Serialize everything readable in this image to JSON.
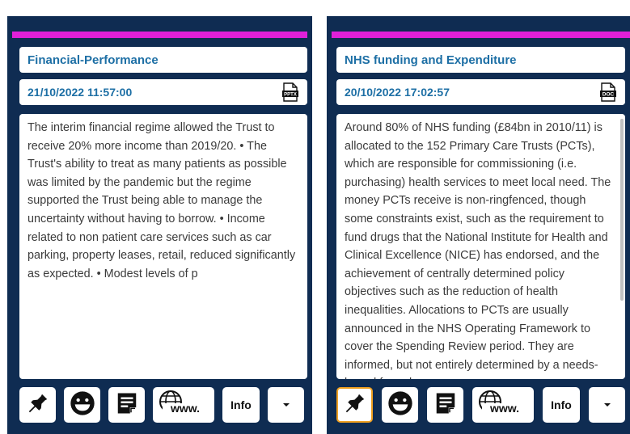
{
  "cards": [
    {
      "title": "Financial-Performance",
      "date": "21/10/2022 11:57:00",
      "file_type": "PPTX",
      "file_icon": "pptx-file-icon",
      "body": "The interim financial regime allowed the Trust to receive 20% more income than 2019/20. • The Trust's ability to treat as many patients as possible was limited by the pandemic but the regime supported the Trust being able to manage the uncertainty without having to borrow. • Income related to non patient care services such as car parking, property leases, retail, reduced significantly as expected. • Modest levels of p",
      "pin_active": false,
      "info_label": "Info"
    },
    {
      "title": "NHS funding and Expenditure",
      "date": "20/10/2022 17:02:57",
      "file_type": "DOC",
      "file_icon": "doc-file-icon",
      "body": "Around 80% of NHS funding (£84bn in 2010/11) is allocated to the 152 Primary Care Trusts (PCTs), which are responsible for commissioning (i.e. purchasing) health services to meet local need. The money PCTs receive is non-ringfenced, though some constraints exist, such as the requirement to fund drugs that the National Institute for Health and Clinical Excellence (NICE) has endorsed, and the achievement of centrally determined policy objectives such as the reduction of health inequalities. Allocations to PCTs are usually announced in the NHS Operating Framework to cover the Spending Review period. They are informed, but not entirely determined by a needs-based formula",
      "pin_active": true,
      "info_label": "Info"
    }
  ],
  "colors": {
    "card_bg": "#0f2c52",
    "accent": "#e020d8",
    "title_text": "#1d6fa5",
    "active_border": "#f0a020"
  },
  "toolbar_icons": [
    "pin-icon",
    "smiley-icon",
    "note-icon",
    "www-icon",
    "info-button",
    "chevron-down-icon"
  ]
}
